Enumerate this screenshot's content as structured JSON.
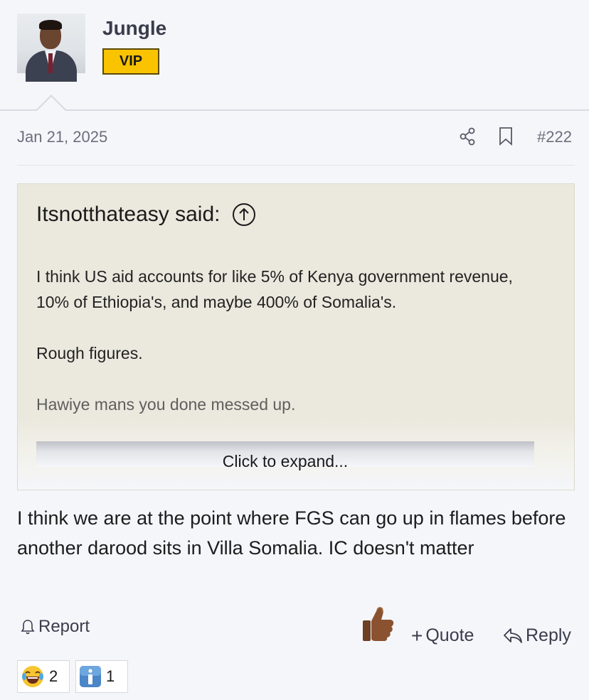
{
  "post": {
    "author": "Jungle",
    "badge": "VIP",
    "date": "Jan 21, 2025",
    "number": "#222",
    "icons": {
      "share": "share-icon",
      "bookmark": "bookmark-icon"
    }
  },
  "quote": {
    "author": "Itsnotthateasy said:",
    "paragraphs": [
      "I think US aid accounts for like 5% of Kenya government revenue, 10% of Ethiopia's, and maybe 400% of Somalia's.",
      "Rough figures.",
      "Hawiye mans you done messed up."
    ],
    "expand_label": "Click to expand..."
  },
  "body": "I think we are at the point where FGS can go up in flames before another darood sits in Villa Somalia. IC doesn't matter",
  "actions": {
    "report_label": "Report",
    "quote_label": "Quote",
    "reply_label": "Reply"
  },
  "reactions": [
    {
      "emoji": "😂",
      "count": "2"
    },
    {
      "emoji": "ℹ️",
      "count": "1"
    }
  ],
  "colors": {
    "vip": "#f9c300",
    "quote_bg": "#ebe9de",
    "page_bg": "#f5f6fa"
  }
}
